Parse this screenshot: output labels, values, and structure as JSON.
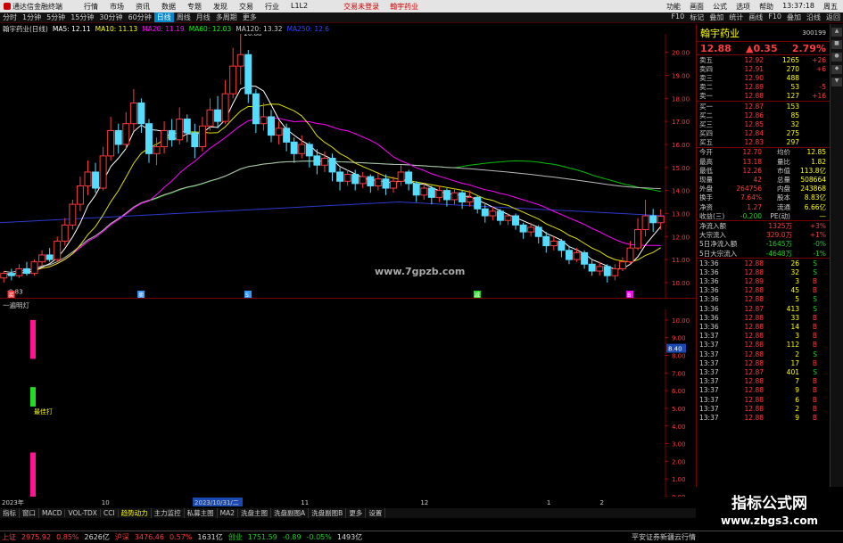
{
  "menubar": {
    "app_title": "通达信金融终端",
    "menus": [
      "行情",
      "市场",
      "资讯",
      "数据",
      "专题",
      "发现",
      "交易",
      "行业",
      "L1L2"
    ],
    "warn": [
      "交易未登录",
      "翰宇药业"
    ],
    "right": [
      "功能",
      "画面",
      "公式",
      "选项",
      "帮助",
      "13:37:18",
      "周五"
    ]
  },
  "toolbar": {
    "items": [
      "分时",
      "1分钟",
      "5分钟",
      "15分钟",
      "30分钟",
      "60分钟",
      "日线",
      "周线",
      "月线",
      "多周期",
      "更多"
    ],
    "selected_index": 6,
    "right": [
      "F10",
      "标记",
      "叠加",
      "统计",
      "画线",
      "F10",
      "叠加",
      "沿线",
      "返回"
    ]
  },
  "stock_title": {
    "name": "翰宇药业(日线)",
    "ma": [
      {
        "label": "MA5: 12.11",
        "color": "#ffffff"
      },
      {
        "label": "MA10: 11.13",
        "color": "#ffff00"
      },
      {
        "label": "MA20: 11.19",
        "color": "#ff00ff"
      },
      {
        "label": "MA60: 12.03",
        "color": "#00ff00"
      },
      {
        "label": "MA120: 13.32",
        "color": "#cccccc"
      },
      {
        "label": "MA250: 12.6",
        "color": "#3344ff"
      }
    ]
  },
  "chart_data": {
    "type": "candlestick",
    "title": "翰宇药业(日线)",
    "price_axis": [
      {
        "v": 20,
        "label": "20.00"
      },
      {
        "v": 19,
        "label": "19.00"
      },
      {
        "v": 18,
        "label": "18.00"
      },
      {
        "v": 17,
        "label": "17.00"
      },
      {
        "v": 16,
        "label": "16.00"
      },
      {
        "v": 15,
        "label": "15.00"
      },
      {
        "v": 14,
        "label": "14.00"
      },
      {
        "v": 13,
        "label": "13.00"
      },
      {
        "v": 12,
        "label": "12.00"
      },
      {
        "v": 11,
        "label": "11.00"
      },
      {
        "v": 10,
        "label": "10.00"
      }
    ],
    "ylim": [
      9.3,
      20.8
    ],
    "high_label": "20.88",
    "low_label": "9.83",
    "candles": [
      [
        10.2,
        10.4,
        10.0,
        10.5
      ],
      [
        10.4,
        10.3,
        10.1,
        10.6
      ],
      [
        10.3,
        10.6,
        10.2,
        10.8
      ],
      [
        10.6,
        10.4,
        10.3,
        10.9
      ],
      [
        10.4,
        10.9,
        10.3,
        11.0
      ],
      [
        10.9,
        11.2,
        10.7,
        11.4
      ],
      [
        11.2,
        11.0,
        10.9,
        11.5
      ],
      [
        11.0,
        11.8,
        10.9,
        12.0
      ],
      [
        11.8,
        12.5,
        11.6,
        12.8
      ],
      [
        12.5,
        13.4,
        12.3,
        13.6
      ],
      [
        13.4,
        14.2,
        13.1,
        14.6
      ],
      [
        14.2,
        14.8,
        13.8,
        15.3
      ],
      [
        14.8,
        14.1,
        13.9,
        15.2
      ],
      [
        14.1,
        15.5,
        14.0,
        15.9
      ],
      [
        15.5,
        16.6,
        15.3,
        17.2
      ],
      [
        16.6,
        16.0,
        15.6,
        16.9
      ],
      [
        16.0,
        16.9,
        15.8,
        17.4
      ],
      [
        16.9,
        17.8,
        16.6,
        18.4
      ],
      [
        17.8,
        16.9,
        16.5,
        18.0
      ],
      [
        16.9,
        15.6,
        15.2,
        17.1
      ],
      [
        15.6,
        15.9,
        15.1,
        16.3
      ],
      [
        15.9,
        16.6,
        15.6,
        17.0
      ],
      [
        16.6,
        16.2,
        15.9,
        17.1
      ],
      [
        16.2,
        17.1,
        16.0,
        17.6
      ],
      [
        17.1,
        16.5,
        16.1,
        17.3
      ],
      [
        16.5,
        15.9,
        15.4,
        16.9
      ],
      [
        15.9,
        16.8,
        15.7,
        17.2
      ],
      [
        16.8,
        17.5,
        16.6,
        18.0
      ],
      [
        17.5,
        17.0,
        16.7,
        18.1
      ],
      [
        17.0,
        18.2,
        16.9,
        18.8
      ],
      [
        18.2,
        19.4,
        18.0,
        20.2
      ],
      [
        19.4,
        19.9,
        18.6,
        20.88
      ],
      [
        19.9,
        18.2,
        17.8,
        20.1
      ],
      [
        18.2,
        16.9,
        16.5,
        18.4
      ],
      [
        16.9,
        17.2,
        16.6,
        17.8
      ],
      [
        17.2,
        16.4,
        16.1,
        17.5
      ],
      [
        16.4,
        16.7,
        16.0,
        17.0
      ],
      [
        16.7,
        16.1,
        15.7,
        16.9
      ],
      [
        16.1,
        15.6,
        15.2,
        16.3
      ],
      [
        15.6,
        16.0,
        15.4,
        16.4
      ],
      [
        16.0,
        15.5,
        15.0,
        16.1
      ],
      [
        15.5,
        15.1,
        14.7,
        15.8
      ],
      [
        15.1,
        15.4,
        14.8,
        15.7
      ],
      [
        15.4,
        14.8,
        14.4,
        15.6
      ],
      [
        14.8,
        14.4,
        14.0,
        15.0
      ],
      [
        14.4,
        14.7,
        14.2,
        14.9
      ],
      [
        14.7,
        14.3,
        14.0,
        14.9
      ],
      [
        14.3,
        14.6,
        14.1,
        14.8
      ],
      [
        14.6,
        14.2,
        13.9,
        14.7
      ],
      [
        14.2,
        14.5,
        14.0,
        14.8
      ],
      [
        14.5,
        14.1,
        13.8,
        14.7
      ],
      [
        14.1,
        14.4,
        13.9,
        14.6
      ],
      [
        14.4,
        14.8,
        14.2,
        15.1
      ],
      [
        14.8,
        14.3,
        14.0,
        14.9
      ],
      [
        14.3,
        13.8,
        13.5,
        14.4
      ],
      [
        13.8,
        14.1,
        13.6,
        14.3
      ],
      [
        14.1,
        13.7,
        13.4,
        14.2
      ],
      [
        13.7,
        14.0,
        13.5,
        14.2
      ],
      [
        14.0,
        13.6,
        13.3,
        14.1
      ],
      [
        13.6,
        13.9,
        13.4,
        14.1
      ],
      [
        13.9,
        13.5,
        13.2,
        14.0
      ],
      [
        13.5,
        13.7,
        13.3,
        14.0
      ],
      [
        13.7,
        13.2,
        13.0,
        13.8
      ],
      [
        13.2,
        12.9,
        12.6,
        13.4
      ],
      [
        12.9,
        13.1,
        12.7,
        13.3
      ],
      [
        13.1,
        12.7,
        12.5,
        13.2
      ],
      [
        12.7,
        12.9,
        12.5,
        13.0
      ],
      [
        12.9,
        12.5,
        12.3,
        13.0
      ],
      [
        12.5,
        12.2,
        11.9,
        12.6
      ],
      [
        12.2,
        12.4,
        12.0,
        12.6
      ],
      [
        12.4,
        12.0,
        11.7,
        12.5
      ],
      [
        12.0,
        11.6,
        11.3,
        12.2
      ],
      [
        11.6,
        11.8,
        11.4,
        12.0
      ],
      [
        11.8,
        11.4,
        11.1,
        11.9
      ],
      [
        11.4,
        11.0,
        10.8,
        11.6
      ],
      [
        11.0,
        11.3,
        10.9,
        11.5
      ],
      [
        11.3,
        10.8,
        10.6,
        11.4
      ],
      [
        10.8,
        10.5,
        10.3,
        11.0
      ],
      [
        10.5,
        10.7,
        10.3,
        10.9
      ],
      [
        10.7,
        10.3,
        10.0,
        10.8
      ],
      [
        10.3,
        10.6,
        10.1,
        10.8
      ],
      [
        10.6,
        10.9,
        10.5,
        11.1
      ],
      [
        10.9,
        11.5,
        10.8,
        11.8
      ],
      [
        11.5,
        12.3,
        11.4,
        12.8
      ],
      [
        12.3,
        12.9,
        12.0,
        13.6
      ],
      [
        12.9,
        12.6,
        12.2,
        13.2
      ],
      [
        12.6,
        12.88,
        12.3,
        13.18
      ]
    ],
    "lower_axis": [
      {
        "v": 10,
        "label": "10.00"
      },
      {
        "v": 9,
        "label": "9.00"
      },
      {
        "v": 8,
        "label": "8.00"
      },
      {
        "v": 7,
        "label": "7.00"
      },
      {
        "v": 6,
        "label": "6.00"
      },
      {
        "v": 5,
        "label": "5.00"
      },
      {
        "v": 4,
        "label": "4.00"
      },
      {
        "v": 3,
        "label": "3.00"
      },
      {
        "v": 2,
        "label": "2.00"
      },
      {
        "v": 1,
        "label": "1.00"
      },
      {
        "v": 0,
        "label": "0.00"
      }
    ],
    "lower_ylim": [
      0,
      10.6
    ],
    "lower_bars": [
      {
        "from": 10,
        "to": 7.8,
        "color": "#ff1493"
      },
      {
        "from": 6.2,
        "to": 5.1,
        "color": "#22dd22"
      },
      {
        "from": 2.5,
        "to": 0,
        "color": "#ff1493"
      }
    ],
    "lower_label": "最佳打",
    "current_marker": "8.40",
    "marks": [
      {
        "i": 1,
        "t": "买",
        "c": "#ff3b3b"
      },
      {
        "i": 18,
        "t": "卖",
        "c": "#3399ff"
      },
      {
        "i": 32,
        "t": "S",
        "c": "#3399ff"
      },
      {
        "i": 62,
        "t": "减",
        "c": "#22dd22"
      },
      {
        "i": 82,
        "t": "B",
        "c": "#ff00ff"
      }
    ],
    "dates": [
      "2023年",
      "10",
      "2023/10/31/二",
      "11",
      "12",
      "1",
      "2"
    ]
  },
  "subtitle": "一遍明灯",
  "watermark_center": "www.7gpzb.com",
  "right": {
    "name": "翰宇药业",
    "code": "300199",
    "price": "12.88",
    "change": "▲0.35",
    "pct": "2.79%",
    "asks": [
      {
        "l": "卖五",
        "p": "12.92",
        "v": "1265",
        "d": "+26"
      },
      {
        "l": "卖四",
        "p": "12.91",
        "v": "270",
        "d": "+6"
      },
      {
        "l": "卖三",
        "p": "12.90",
        "v": "488",
        "d": ""
      },
      {
        "l": "卖二",
        "p": "12.89",
        "v": "53",
        "d": "-5"
      },
      {
        "l": "卖一",
        "p": "12.88",
        "v": "127",
        "d": "+16"
      }
    ],
    "bids": [
      {
        "l": "买一",
        "p": "12.87",
        "v": "153",
        "d": ""
      },
      {
        "l": "买二",
        "p": "12.86",
        "v": "85",
        "d": ""
      },
      {
        "l": "买三",
        "p": "12.85",
        "v": "32",
        "d": ""
      },
      {
        "l": "买四",
        "p": "12.84",
        "v": "275",
        "d": ""
      },
      {
        "l": "买五",
        "p": "12.83",
        "v": "297",
        "d": ""
      }
    ],
    "stats": [
      [
        "今开",
        "12.70",
        "均价",
        "12.85"
      ],
      [
        "最高",
        "13.18",
        "量比",
        "1.82"
      ],
      [
        "最低",
        "12.26",
        "市值",
        "113.8亿"
      ],
      [
        "现量",
        "42",
        "总量",
        "508664"
      ],
      [
        "外盘",
        "264756",
        "内盘",
        "243868"
      ],
      [
        "换手",
        "7.64%",
        "股本",
        "8.83亿"
      ],
      [
        "净资",
        "1.27",
        "流通",
        "6.66亿"
      ],
      [
        "收益(三)",
        "-0.200",
        "PE(动)",
        "—"
      ]
    ],
    "flows": [
      [
        "净流入额",
        "1325万",
        "+3%"
      ],
      [
        "大宗流入",
        "329.0万",
        "+1%"
      ],
      [
        "5日净流入额",
        "-1645万",
        "-0%"
      ],
      [
        "5日大宗流入",
        "-4648万",
        "-1%"
      ]
    ],
    "ticks": [
      [
        "13:36",
        "12.88",
        "26",
        "S"
      ],
      [
        "13:36",
        "12.88",
        "32",
        "S"
      ],
      [
        "13:36",
        "12.89",
        "3",
        "B"
      ],
      [
        "13:36",
        "12.88",
        "45",
        "B"
      ],
      [
        "13:36",
        "12.88",
        "5",
        "S"
      ],
      [
        "13:36",
        "12.87",
        "413",
        "S"
      ],
      [
        "13:36",
        "12.88",
        "33",
        "B"
      ],
      [
        "13:36",
        "12.88",
        "14",
        "B"
      ],
      [
        "13:37",
        "12.88",
        "3",
        "B"
      ],
      [
        "13:37",
        "12.88",
        "112",
        "B"
      ],
      [
        "13:37",
        "12.88",
        "2",
        "S"
      ],
      [
        "13:37",
        "12.88",
        "17",
        "B"
      ],
      [
        "13:37",
        "12.87",
        "401",
        "S"
      ],
      [
        "13:37",
        "12.88",
        "7",
        "B"
      ],
      [
        "13:37",
        "12.88",
        "9",
        "B"
      ],
      [
        "13:37",
        "12.88",
        "6",
        "B"
      ],
      [
        "13:37",
        "12.88",
        "2",
        "B"
      ],
      [
        "13:37",
        "12.88",
        "9",
        "B"
      ]
    ]
  },
  "bottom_tabs": [
    "指标",
    "窗口",
    "MACD",
    "VOL-TDX",
    "CCI",
    "趋势动力",
    "主力监控",
    "私募主图",
    "MA2",
    "洗盘主图",
    "洗盘副图A",
    "洗盘副图B",
    "更多",
    "设置"
  ],
  "status": {
    "sh": "上证",
    "sh_v": "2975.92",
    "sh_d": "0.85%",
    "sh_amt": "2626亿",
    "sz": "沪深",
    "sz_v": "3476.46",
    "sz_d": "0.57%",
    "sz_amt": "1631亿",
    "cy": "创业",
    "cy_v": "1751.59",
    "cy_d": "-0.89",
    "cy_p": "-0.05%",
    "cy_amt": "1493亿",
    "feed": "平安证券新疆云行情"
  },
  "brand": {
    "line1": "指标公式网",
    "line2": "www.zbgs3.com"
  }
}
